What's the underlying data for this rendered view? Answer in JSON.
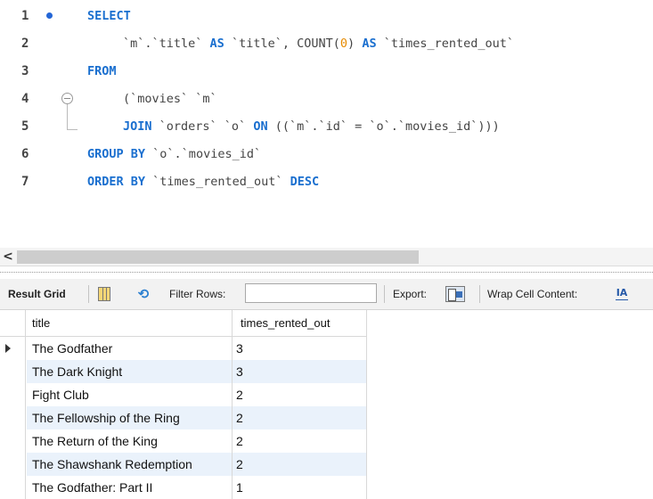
{
  "editor": {
    "lines": [
      {
        "num": "1"
      },
      {
        "num": "2"
      },
      {
        "num": "3"
      },
      {
        "num": "4"
      },
      {
        "num": "5"
      },
      {
        "num": "6"
      },
      {
        "num": "7"
      }
    ],
    "kw_select": "SELECT",
    "l2_a": "`m`.`title`",
    "kw_as1": "AS",
    "l2_b": "`title`,",
    "l2_fn": "COUNT(",
    "l2_num": "0",
    "l2_fn_close": ")",
    "kw_as2": "AS",
    "l2_c": "`times_rented_out`",
    "kw_from": "FROM",
    "l4": "(`movies` `m`",
    "kw_join": "JOIN",
    "l5_a": "`orders` `o`",
    "kw_on": "ON",
    "l5_b": "((`m`.`id` = `o`.`movies_id`)))",
    "kw_groupby": "GROUP BY",
    "l6": "`o`.`movies_id`",
    "kw_orderby": "ORDER BY",
    "l7": "`times_rented_out`",
    "kw_desc": "DESC"
  },
  "toolbar": {
    "result_grid": "Result Grid",
    "filter_rows": "Filter Rows:",
    "filter_value": "",
    "export": "Export:",
    "wrap": "Wrap Cell Content:",
    "wrap_icon": "IA"
  },
  "grid": {
    "columns": [
      "title",
      "times_rented_out"
    ],
    "rows": [
      {
        "title": "The Godfather",
        "times": "3"
      },
      {
        "title": "The Dark Knight",
        "times": "3"
      },
      {
        "title": "Fight Club",
        "times": "2"
      },
      {
        "title": "The Fellowship of the Ring",
        "times": "2"
      },
      {
        "title": "The Return of the King",
        "times": "2"
      },
      {
        "title": "The Shawshank Redemption",
        "times": "2"
      },
      {
        "title": "The Godfather: Part II",
        "times": "1"
      }
    ]
  },
  "scroll_arrow": "<"
}
